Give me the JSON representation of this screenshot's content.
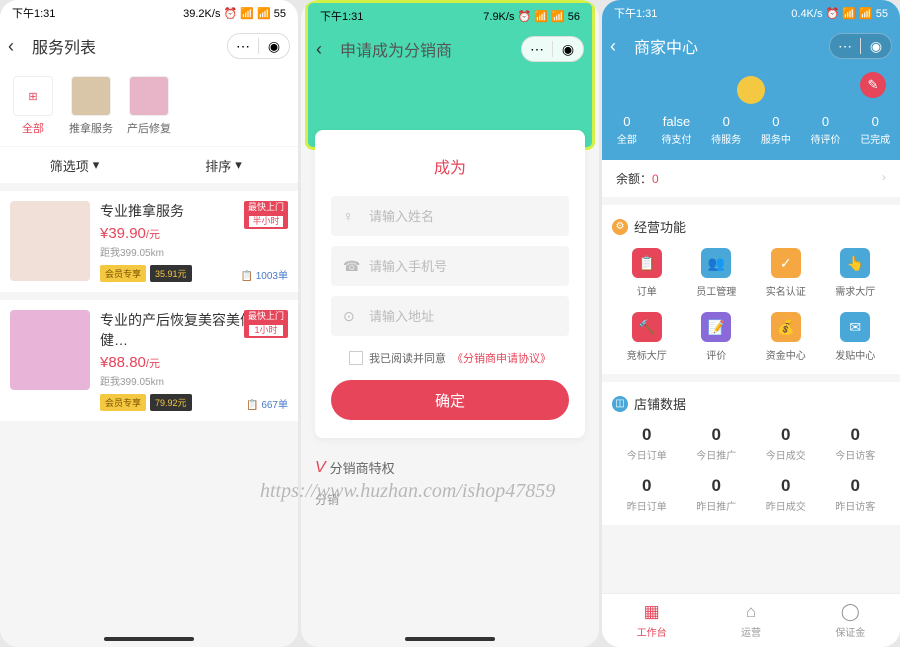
{
  "status": {
    "time": "下午1:31",
    "signals": "39.2K/s ⏰ 📶 📶 55",
    "time2": "下午1:31",
    "sig2": "7.9K/s ⏰ 📶 📶 56",
    "time3": "下午1:31",
    "sig3": "0.4K/s ⏰ 📶 📶 55"
  },
  "s1": {
    "title": "服务列表",
    "cats": [
      {
        "label": "全部",
        "active": true
      },
      {
        "label": "推拿服务"
      },
      {
        "label": "产后修复"
      }
    ],
    "filter": "筛选项",
    "sort": "排序",
    "items": [
      {
        "title": "专业推拿服务",
        "price": "¥39.90",
        "unit": "/元",
        "dist": "距我399.05km",
        "vip": "会员专享",
        "vprice": "35.91元",
        "door": "最快上门",
        "dtime": "半小时",
        "orders": "1003单"
      },
      {
        "title": "专业的产后恢复美容美体保健…",
        "price": "¥88.80",
        "unit": "/元",
        "dist": "距我399.05km",
        "vip": "会员专享",
        "vprice": "79.92元",
        "door": "最快上门",
        "dtime": "1小时",
        "orders": "667单"
      }
    ]
  },
  "s2": {
    "title": "申请成为分销商",
    "form_title": "成为",
    "ph_name": "请输入姓名",
    "ph_phone": "请输入手机号",
    "ph_addr": "请输入地址",
    "agree": "我已阅读并同意",
    "agree_link": "《分销商申请协议》",
    "submit": "确定",
    "priv_title": "分销商特权",
    "priv_sub": "分销"
  },
  "s3": {
    "title": "商家中心",
    "stats": [
      {
        "n": "0",
        "l": "全部"
      },
      {
        "n": "false",
        "l": "待支付"
      },
      {
        "n": "0",
        "l": "待服务"
      },
      {
        "n": "0",
        "l": "服务中"
      },
      {
        "n": "0",
        "l": "待评价"
      },
      {
        "n": "0",
        "l": "已完成"
      }
    ],
    "balance_lbl": "余额：",
    "balance_val": "0",
    "func_title": "经营功能",
    "funcs": [
      {
        "l": "订单",
        "c": "#e6455a",
        "i": "📋"
      },
      {
        "l": "员工管理",
        "c": "#4aa8d8",
        "i": "👥"
      },
      {
        "l": "实名认证",
        "c": "#f5a742",
        "i": "✓"
      },
      {
        "l": "需求大厅",
        "c": "#4aa8d8",
        "i": "👆"
      },
      {
        "l": "竞标大厅",
        "c": "#e6455a",
        "i": "🔨"
      },
      {
        "l": "评价",
        "c": "#8a6ad8",
        "i": "📝"
      },
      {
        "l": "资金中心",
        "c": "#f5a742",
        "i": "💰"
      },
      {
        "l": "发贴中心",
        "c": "#4aa8d8",
        "i": "✉"
      }
    ],
    "data_title": "店铺数据",
    "data_today": [
      {
        "n": "0",
        "l": "今日订单"
      },
      {
        "n": "0",
        "l": "今日推广"
      },
      {
        "n": "0",
        "l": "今日成交"
      },
      {
        "n": "0",
        "l": "今日访客"
      }
    ],
    "data_yest": [
      {
        "n": "0",
        "l": "昨日订单"
      },
      {
        "n": "0",
        "l": "昨日推广"
      },
      {
        "n": "0",
        "l": "昨日成交"
      },
      {
        "n": "0",
        "l": "昨日访客"
      }
    ],
    "tabs": [
      {
        "l": "工作台",
        "i": "▦",
        "active": true
      },
      {
        "l": "运营",
        "i": "⌂"
      },
      {
        "l": "保证金",
        "i": "◯"
      }
    ]
  },
  "watermark": "https://www.huzhan.com/ishop47859"
}
